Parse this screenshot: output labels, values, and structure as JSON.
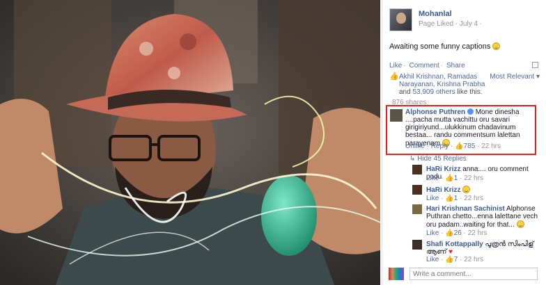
{
  "post": {
    "page_name": "Mohanlal",
    "page_meta": "Page Liked · July 4 ·",
    "text": "Awaiting some funny captions"
  },
  "actions": {
    "like": "Like",
    "comment": "Comment",
    "share": "Share"
  },
  "likes": {
    "names": "Akhil Krishnan, Ramadas Narayanan, Krishna Prabha",
    "joiner": "and",
    "others": "53,909 others",
    "suffix": "like this.",
    "sort": "Most Relevant"
  },
  "shares": "876 shares",
  "hide_replies": "Hide 45 Replies",
  "comments": [
    {
      "author": "Alphonse Puthren",
      "text": "Mone dinesha ....pacha mutta vachittu oru savari girigiriyund...ulukkinum chadavinum bestaa... randu commentsum lalettan parayenam",
      "like": "Unlike",
      "reply": "Reply",
      "count": "785",
      "time": "22 hrs"
    }
  ],
  "replies": [
    {
      "author": "HaRi Krizz",
      "text": "anna.... oru comment podu",
      "like": "Like",
      "count": "1",
      "time": "22 hrs"
    },
    {
      "author": "HaRi Krizz",
      "text": "",
      "like": "Like",
      "count": "1",
      "time": "22 hrs"
    },
    {
      "author": "Hari Krishnan Sachinist",
      "text": "Alphonse Puthran chetto...enna lalettane vech oru padam..waiting for that...",
      "like": "Like",
      "count": "26",
      "time": "22 hrs"
    },
    {
      "author": "Shafi Kottappally",
      "text": "പുത്രൻ സിംപിള്",
      "text2": "ആണ്",
      "like": "Like",
      "count": "7",
      "time": "22 hrs"
    }
  ],
  "composer": {
    "placeholder": "Write a comment..."
  },
  "colors": {
    "link": "#3b5998",
    "highlight": "#e32219",
    "muted": "#90949c"
  }
}
